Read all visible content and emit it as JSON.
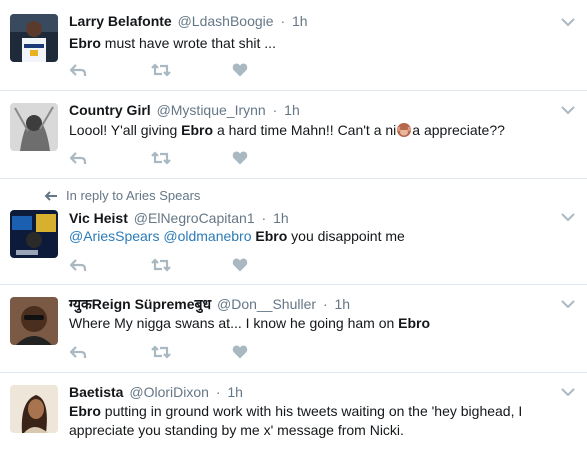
{
  "colors": {
    "accent": "#2b7bb9",
    "muted": "#657786",
    "icon": "#aab8c2",
    "divider": "#e1e8ed"
  },
  "icons": {
    "reply": "reply-icon",
    "retweet": "retweet-icon",
    "like": "heart-icon",
    "menu": "chevron-down-icon"
  },
  "tweets": [
    {
      "name": "Larry Belafonte",
      "handle": "@LdashBoogie",
      "time": "1h",
      "text_bold": "Ebro",
      "text_rest": " must have wrote that shit ..."
    },
    {
      "name": "Country Girl",
      "handle": "@Mystique_Irynn",
      "time": "1h",
      "text_pre": "Loool! Y'all giving ",
      "text_bold": "Ebro",
      "text_mid": " a hard time Mahn!! Can't a ni",
      "text_post": "a appreciate??"
    },
    {
      "reply_context": "In reply to Aries Spears",
      "name": "Vic Heist",
      "handle": "@ElNegroCapitan1",
      "time": "1h",
      "mention1": "@AriesSpears",
      "mention2": "@oldmanebro",
      "text_bold": "Ebro",
      "text_rest": " you disappoint me"
    },
    {
      "name": "ग्युकReign Süpremeबुध",
      "handle": "@Don__Shuller",
      "time": "1h",
      "text_pre": "Where My nigga swans at... I know he going ham on ",
      "text_bold": "Ebro"
    },
    {
      "name": "Baetista",
      "handle": "@OloriDixon",
      "time": "1h",
      "text_bold": "Ebro",
      "text_line1": " putting in ground work with his tweets waiting on the 'hey bighead, I",
      "text_line2": "appreciate you standing by me x' message from Nicki."
    }
  ]
}
